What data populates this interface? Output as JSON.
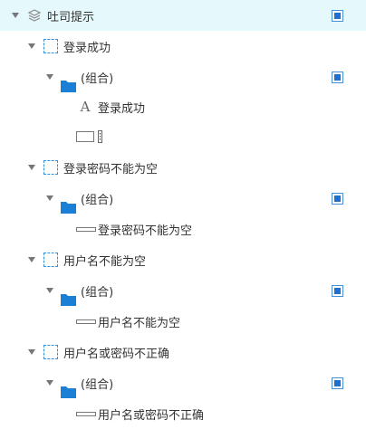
{
  "tree": {
    "root": {
      "label": "吐司提示",
      "icon": "layers-icon",
      "visible": true
    },
    "groups": [
      {
        "label": "登录成功",
        "icon": "dynamic-panel-icon",
        "child": {
          "label": "(组合)",
          "icon": "folder-icon",
          "visible": true
        },
        "items": [
          {
            "label": "登录成功",
            "icon": "text-icon"
          },
          {
            "label": "",
            "icon": "rectangle-icon"
          }
        ]
      },
      {
        "label": "登录密码不能为空",
        "icon": "dynamic-panel-icon",
        "child": {
          "label": "(组合)",
          "icon": "folder-icon",
          "visible": true
        },
        "items": [
          {
            "label": "登录密码不能为空",
            "icon": "line-rect-icon"
          }
        ]
      },
      {
        "label": "用户名不能为空",
        "icon": "dynamic-panel-icon",
        "child": {
          "label": "(组合)",
          "icon": "folder-icon",
          "visible": true
        },
        "items": [
          {
            "label": "用户名不能为空",
            "icon": "line-rect-icon"
          }
        ]
      },
      {
        "label": "用户名或密码不正确",
        "icon": "dynamic-panel-icon",
        "child": {
          "label": "(组合)",
          "icon": "folder-icon",
          "visible": true
        },
        "items": [
          {
            "label": "用户名或密码不正确",
            "icon": "line-rect-icon"
          }
        ]
      }
    ]
  },
  "colors": {
    "selected_bg": "#e5f8fb",
    "accent": "#1f6fd1",
    "folder": "#1b7fd6"
  }
}
